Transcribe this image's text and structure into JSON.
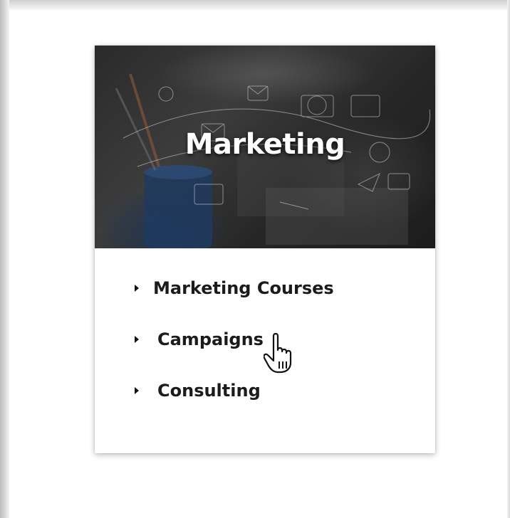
{
  "card": {
    "title": "Marketing",
    "menu": [
      {
        "label": "Marketing Courses"
      },
      {
        "label": "Campaigns"
      },
      {
        "label": "Consulting"
      }
    ]
  },
  "colors": {
    "hero_overlay": "#2b2b2b",
    "menu_text": "#1b1b1b",
    "title_text": "#ffffff"
  },
  "icons": {
    "menu_bullet": "caret-right-icon",
    "pointer": "hand-pointer-icon"
  }
}
